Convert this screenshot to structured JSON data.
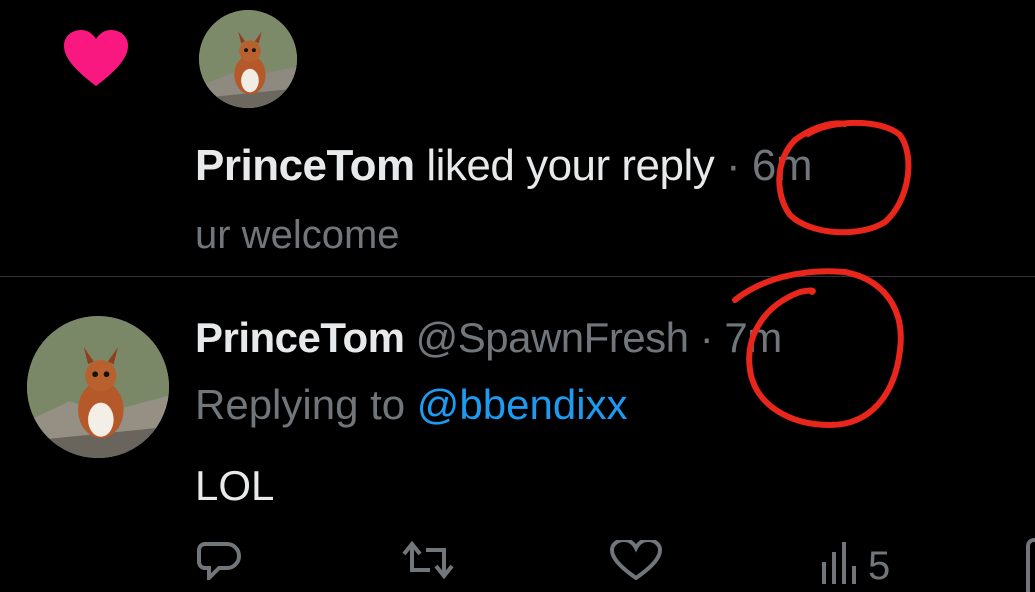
{
  "notification": {
    "icon": "heart-icon",
    "icon_color": "#f91880",
    "user": "PrinceTom",
    "action": "liked your reply",
    "separator": "·",
    "time": "6m",
    "snippet": "ur welcome"
  },
  "tweet": {
    "display_name": "PrinceTom",
    "handle": "@SpawnFresh",
    "separator": "·",
    "time": "7m",
    "replying_label": "Replying to",
    "replying_to": "@bbendixx",
    "body": "LOL",
    "actions": {
      "reply": "reply-icon",
      "retweet": "retweet-icon",
      "like": "like-icon",
      "views": "views-icon",
      "views_count": "5"
    }
  },
  "colors": {
    "background": "#000000",
    "text": "#e7e9ea",
    "muted": "#71767b",
    "link": "#1d9bf0",
    "annotation": "#e8261b"
  }
}
